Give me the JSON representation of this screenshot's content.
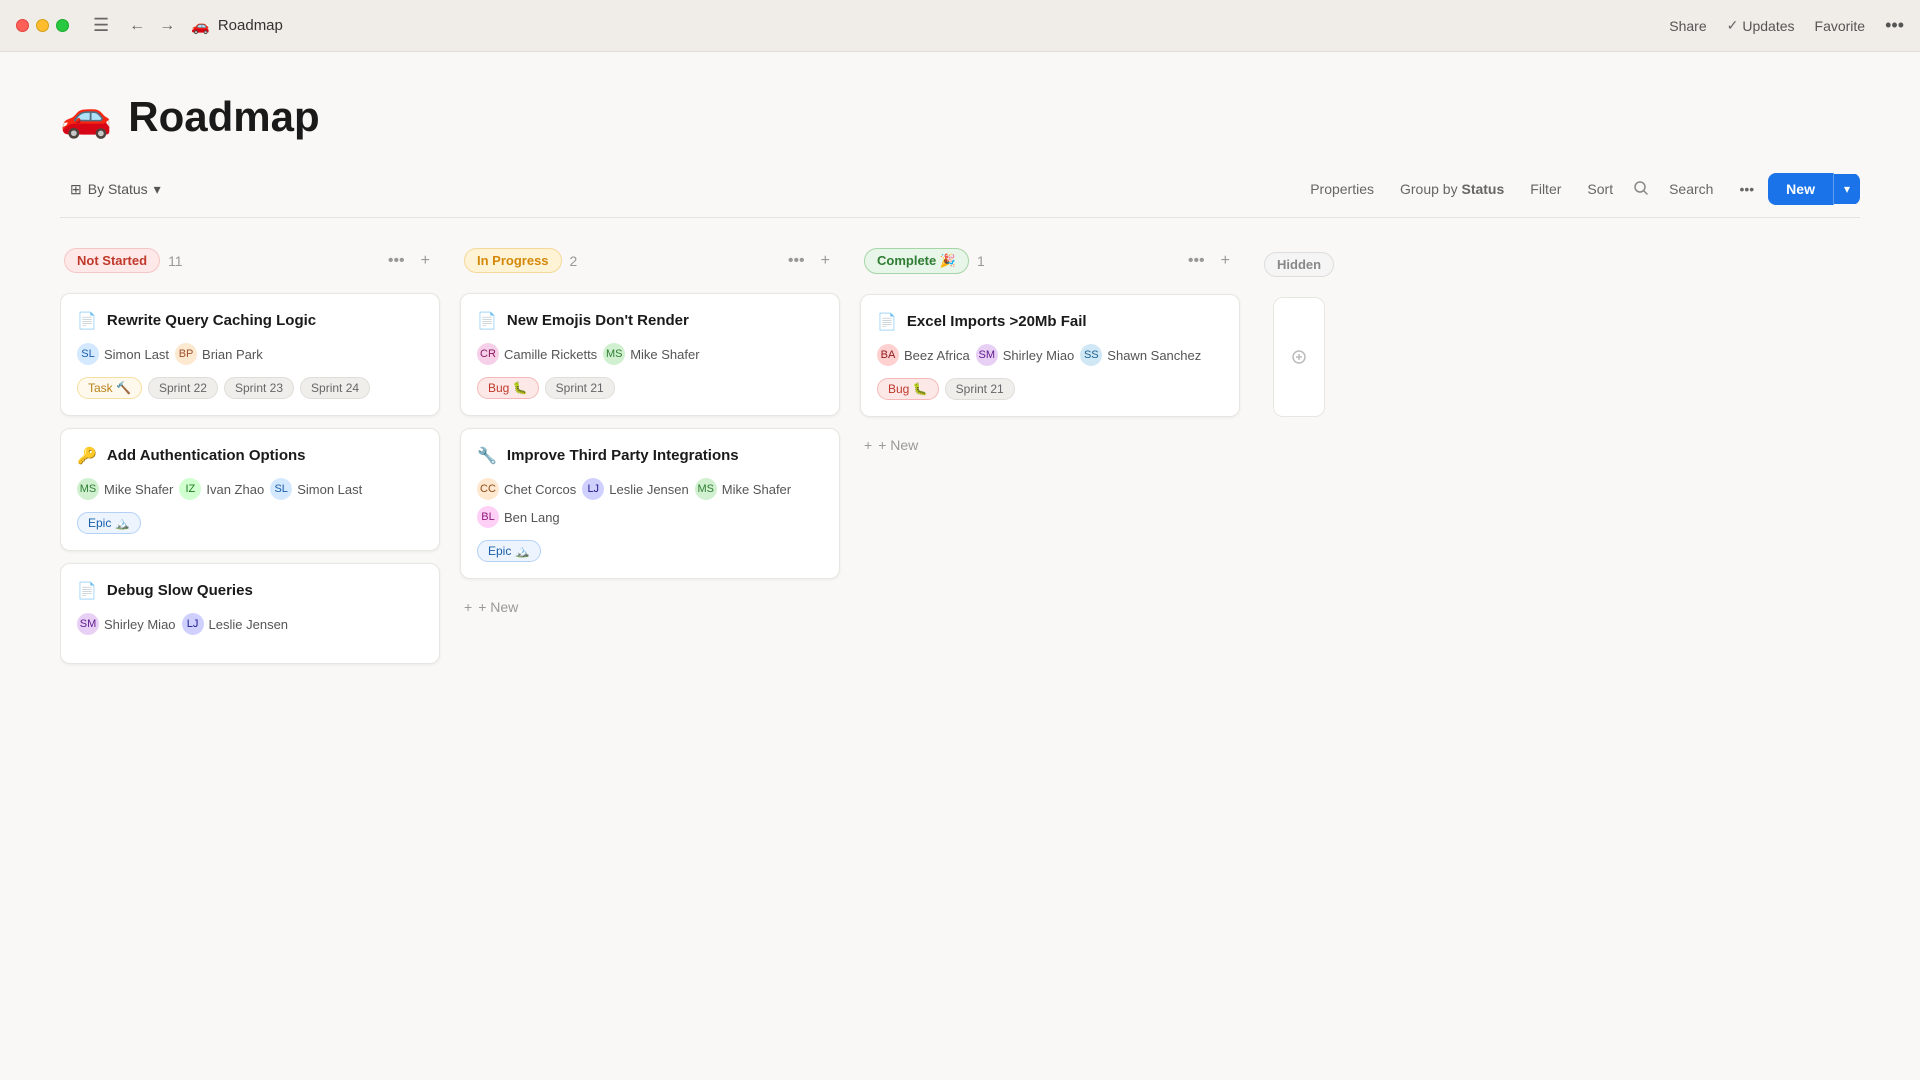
{
  "titleBar": {
    "title": "Roadmap",
    "emoji": "🚗",
    "shareLabel": "Share",
    "updatesLabel": "Updates",
    "favoriteLabel": "Favorite"
  },
  "page": {
    "emoji": "🚗",
    "title": "Roadmap"
  },
  "toolbar": {
    "byStatusLabel": "By Status",
    "propertiesLabel": "Properties",
    "groupByLabel": "Group by",
    "groupByValue": "Status",
    "filterLabel": "Filter",
    "sortLabel": "Sort",
    "searchLabel": "Search",
    "newLabel": "New"
  },
  "columns": [
    {
      "id": "not-started",
      "statusLabel": "Not Started",
      "count": "11",
      "badgeClass": "badge-not-started",
      "cards": [
        {
          "id": "card-1",
          "icon": "📄",
          "title": "Rewrite Query Caching Logic",
          "assignees": [
            {
              "name": "Simon Last",
              "initials": "SL",
              "class": "av-simon"
            },
            {
              "name": "Brian Park",
              "initials": "BP",
              "class": "av-brian"
            }
          ],
          "tags": [
            {
              "label": "Task 🔨",
              "class": "tag-task"
            }
          ],
          "sprints": [
            "Sprint 22",
            "Sprint 23",
            "Sprint 24"
          ]
        },
        {
          "id": "card-2",
          "icon": "🔑",
          "title": "Add Authentication Options",
          "assignees": [
            {
              "name": "Mike Shafer",
              "initials": "MS",
              "class": "av-mike"
            },
            {
              "name": "Ivan Zhao",
              "initials": "IZ",
              "class": "av-ivan"
            },
            {
              "name": "Simon Last",
              "initials": "SL",
              "class": "av-simon"
            }
          ],
          "tags": [
            {
              "label": "Epic 🏔️",
              "class": "tag-epic"
            }
          ],
          "sprints": []
        },
        {
          "id": "card-3",
          "icon": "📄",
          "title": "Debug Slow Queries",
          "assignees": [
            {
              "name": "Shirley Miao",
              "initials": "SM",
              "class": "av-shirley"
            },
            {
              "name": "Leslie Jensen",
              "initials": "LJ",
              "class": "av-leslie"
            }
          ],
          "tags": [],
          "sprints": []
        }
      ]
    },
    {
      "id": "in-progress",
      "statusLabel": "In Progress",
      "count": "2",
      "badgeClass": "badge-in-progress",
      "cards": [
        {
          "id": "card-4",
          "icon": "📄",
          "title": "New Emojis Don't Render",
          "assignees": [
            {
              "name": "Camille Ricketts",
              "initials": "CR",
              "class": "av-camille"
            },
            {
              "name": "Mike Shafer",
              "initials": "MS",
              "class": "av-mike"
            }
          ],
          "tags": [
            {
              "label": "Bug 🐛",
              "class": "tag-bug"
            }
          ],
          "sprints": [
            "Sprint 21"
          ]
        },
        {
          "id": "card-5",
          "icon": "🔧",
          "title": "Improve Third Party Integrations",
          "assignees": [
            {
              "name": "Chet Corcos",
              "initials": "CC",
              "class": "av-chet"
            },
            {
              "name": "Leslie Jensen",
              "initials": "LJ",
              "class": "av-leslie"
            },
            {
              "name": "Mike Shafer",
              "initials": "MS",
              "class": "av-mike"
            },
            {
              "name": "Ben Lang",
              "initials": "BL",
              "class": "av-ben"
            }
          ],
          "tags": [
            {
              "label": "Epic 🏔️",
              "class": "tag-epic"
            }
          ],
          "sprints": []
        }
      ]
    },
    {
      "id": "complete",
      "statusLabel": "Complete 🎉",
      "count": "1",
      "badgeClass": "badge-complete",
      "cards": [
        {
          "id": "card-6",
          "icon": "📄",
          "title": "Excel Imports >20Mb Fail",
          "assignees": [
            {
              "name": "Beez Africa",
              "initials": "BA",
              "class": "av-beez"
            },
            {
              "name": "Shirley Miao",
              "initials": "SM",
              "class": "av-shirley"
            },
            {
              "name": "Shawn Sanchez",
              "initials": "SS",
              "class": "av-shawn"
            }
          ],
          "tags": [
            {
              "label": "Bug 🐛",
              "class": "tag-bug"
            }
          ],
          "sprints": [
            "Sprint 21"
          ]
        }
      ]
    }
  ],
  "hiddenColumn": {
    "label": "Hidden"
  },
  "addNewLabel": "+ New"
}
